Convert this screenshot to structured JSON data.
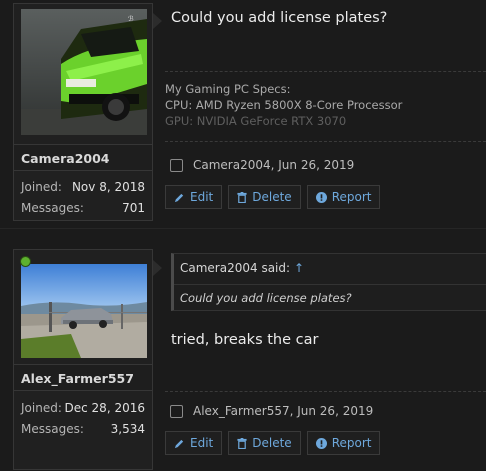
{
  "posts": [
    {
      "username": "Camera2004",
      "joined_label": "Joined:",
      "joined": "Nov 8, 2018",
      "messages_label": "Messages:",
      "messages": "701",
      "message": "Could you add license plates?",
      "signature": {
        "line1": "My Gaming PC Specs:",
        "line2": "CPU: AMD Ryzen 5800X 8-Core Processor",
        "line3": "GPU: NVIDIA GeForce RTX 3070"
      },
      "meta": "Camera2004, Jun 26, 2019",
      "online": false
    },
    {
      "username": "Alex_Farmer557",
      "joined_label": "Joined:",
      "joined": "Dec 28, 2016",
      "messages_label": "Messages:",
      "messages": "3,534",
      "quote": {
        "author": "Camera2004 said:",
        "arrow": "↑",
        "text": "Could you add license plates?"
      },
      "message": "tried, breaks the car",
      "meta": "Alex_Farmer557, Jun 26, 2019",
      "online": true
    }
  ],
  "actions": {
    "edit": "Edit",
    "delete": "Delete",
    "report": "Report"
  },
  "icons": [
    "pencil-icon",
    "trash-icon",
    "report-icon",
    "online-indicator",
    "quote-jump-icon"
  ],
  "colors": {
    "accent": "#6ea8dc",
    "online": "#5db12e",
    "background": "#1b1b1b"
  }
}
